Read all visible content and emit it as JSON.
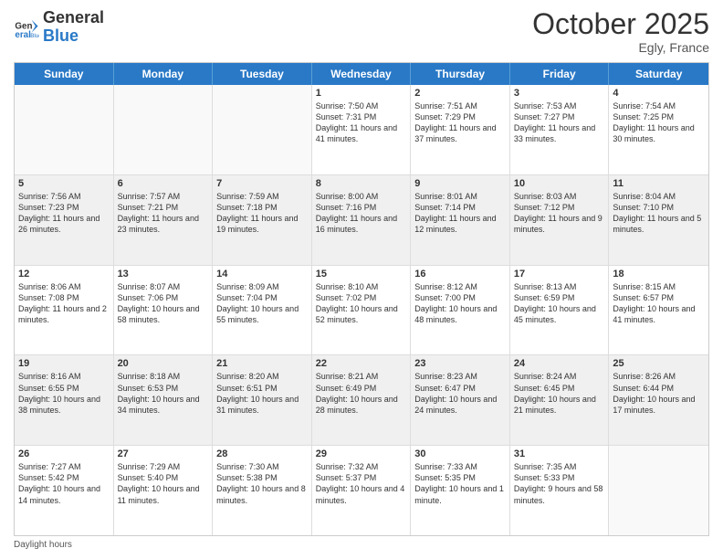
{
  "header": {
    "logo_general": "General",
    "logo_blue": "Blue",
    "month_title": "October 2025",
    "location": "Egly, France"
  },
  "days_of_week": [
    "Sunday",
    "Monday",
    "Tuesday",
    "Wednesday",
    "Thursday",
    "Friday",
    "Saturday"
  ],
  "rows": [
    {
      "cells": [
        {
          "day": "",
          "empty": true
        },
        {
          "day": "",
          "empty": true
        },
        {
          "day": "",
          "empty": true
        },
        {
          "day": "1",
          "sunrise": "Sunrise: 7:50 AM",
          "sunset": "Sunset: 7:31 PM",
          "daylight": "Daylight: 11 hours and 41 minutes."
        },
        {
          "day": "2",
          "sunrise": "Sunrise: 7:51 AM",
          "sunset": "Sunset: 7:29 PM",
          "daylight": "Daylight: 11 hours and 37 minutes."
        },
        {
          "day": "3",
          "sunrise": "Sunrise: 7:53 AM",
          "sunset": "Sunset: 7:27 PM",
          "daylight": "Daylight: 11 hours and 33 minutes."
        },
        {
          "day": "4",
          "sunrise": "Sunrise: 7:54 AM",
          "sunset": "Sunset: 7:25 PM",
          "daylight": "Daylight: 11 hours and 30 minutes."
        }
      ]
    },
    {
      "cells": [
        {
          "day": "5",
          "sunrise": "Sunrise: 7:56 AM",
          "sunset": "Sunset: 7:23 PM",
          "daylight": "Daylight: 11 hours and 26 minutes."
        },
        {
          "day": "6",
          "sunrise": "Sunrise: 7:57 AM",
          "sunset": "Sunset: 7:21 PM",
          "daylight": "Daylight: 11 hours and 23 minutes."
        },
        {
          "day": "7",
          "sunrise": "Sunrise: 7:59 AM",
          "sunset": "Sunset: 7:18 PM",
          "daylight": "Daylight: 11 hours and 19 minutes."
        },
        {
          "day": "8",
          "sunrise": "Sunrise: 8:00 AM",
          "sunset": "Sunset: 7:16 PM",
          "daylight": "Daylight: 11 hours and 16 minutes."
        },
        {
          "day": "9",
          "sunrise": "Sunrise: 8:01 AM",
          "sunset": "Sunset: 7:14 PM",
          "daylight": "Daylight: 11 hours and 12 minutes."
        },
        {
          "day": "10",
          "sunrise": "Sunrise: 8:03 AM",
          "sunset": "Sunset: 7:12 PM",
          "daylight": "Daylight: 11 hours and 9 minutes."
        },
        {
          "day": "11",
          "sunrise": "Sunrise: 8:04 AM",
          "sunset": "Sunset: 7:10 PM",
          "daylight": "Daylight: 11 hours and 5 minutes."
        }
      ]
    },
    {
      "cells": [
        {
          "day": "12",
          "sunrise": "Sunrise: 8:06 AM",
          "sunset": "Sunset: 7:08 PM",
          "daylight": "Daylight: 11 hours and 2 minutes."
        },
        {
          "day": "13",
          "sunrise": "Sunrise: 8:07 AM",
          "sunset": "Sunset: 7:06 PM",
          "daylight": "Daylight: 10 hours and 58 minutes."
        },
        {
          "day": "14",
          "sunrise": "Sunrise: 8:09 AM",
          "sunset": "Sunset: 7:04 PM",
          "daylight": "Daylight: 10 hours and 55 minutes."
        },
        {
          "day": "15",
          "sunrise": "Sunrise: 8:10 AM",
          "sunset": "Sunset: 7:02 PM",
          "daylight": "Daylight: 10 hours and 52 minutes."
        },
        {
          "day": "16",
          "sunrise": "Sunrise: 8:12 AM",
          "sunset": "Sunset: 7:00 PM",
          "daylight": "Daylight: 10 hours and 48 minutes."
        },
        {
          "day": "17",
          "sunrise": "Sunrise: 8:13 AM",
          "sunset": "Sunset: 6:59 PM",
          "daylight": "Daylight: 10 hours and 45 minutes."
        },
        {
          "day": "18",
          "sunrise": "Sunrise: 8:15 AM",
          "sunset": "Sunset: 6:57 PM",
          "daylight": "Daylight: 10 hours and 41 minutes."
        }
      ]
    },
    {
      "cells": [
        {
          "day": "19",
          "sunrise": "Sunrise: 8:16 AM",
          "sunset": "Sunset: 6:55 PM",
          "daylight": "Daylight: 10 hours and 38 minutes."
        },
        {
          "day": "20",
          "sunrise": "Sunrise: 8:18 AM",
          "sunset": "Sunset: 6:53 PM",
          "daylight": "Daylight: 10 hours and 34 minutes."
        },
        {
          "day": "21",
          "sunrise": "Sunrise: 8:20 AM",
          "sunset": "Sunset: 6:51 PM",
          "daylight": "Daylight: 10 hours and 31 minutes."
        },
        {
          "day": "22",
          "sunrise": "Sunrise: 8:21 AM",
          "sunset": "Sunset: 6:49 PM",
          "daylight": "Daylight: 10 hours and 28 minutes."
        },
        {
          "day": "23",
          "sunrise": "Sunrise: 8:23 AM",
          "sunset": "Sunset: 6:47 PM",
          "daylight": "Daylight: 10 hours and 24 minutes."
        },
        {
          "day": "24",
          "sunrise": "Sunrise: 8:24 AM",
          "sunset": "Sunset: 6:45 PM",
          "daylight": "Daylight: 10 hours and 21 minutes."
        },
        {
          "day": "25",
          "sunrise": "Sunrise: 8:26 AM",
          "sunset": "Sunset: 6:44 PM",
          "daylight": "Daylight: 10 hours and 17 minutes."
        }
      ]
    },
    {
      "cells": [
        {
          "day": "26",
          "sunrise": "Sunrise: 7:27 AM",
          "sunset": "Sunset: 5:42 PM",
          "daylight": "Daylight: 10 hours and 14 minutes."
        },
        {
          "day": "27",
          "sunrise": "Sunrise: 7:29 AM",
          "sunset": "Sunset: 5:40 PM",
          "daylight": "Daylight: 10 hours and 11 minutes."
        },
        {
          "day": "28",
          "sunrise": "Sunrise: 7:30 AM",
          "sunset": "Sunset: 5:38 PM",
          "daylight": "Daylight: 10 hours and 8 minutes."
        },
        {
          "day": "29",
          "sunrise": "Sunrise: 7:32 AM",
          "sunset": "Sunset: 5:37 PM",
          "daylight": "Daylight: 10 hours and 4 minutes."
        },
        {
          "day": "30",
          "sunrise": "Sunrise: 7:33 AM",
          "sunset": "Sunset: 5:35 PM",
          "daylight": "Daylight: 10 hours and 1 minute."
        },
        {
          "day": "31",
          "sunrise": "Sunrise: 7:35 AM",
          "sunset": "Sunset: 5:33 PM",
          "daylight": "Daylight: 9 hours and 58 minutes."
        },
        {
          "day": "",
          "empty": true
        }
      ]
    }
  ],
  "footer": {
    "daylight_label": "Daylight hours"
  }
}
